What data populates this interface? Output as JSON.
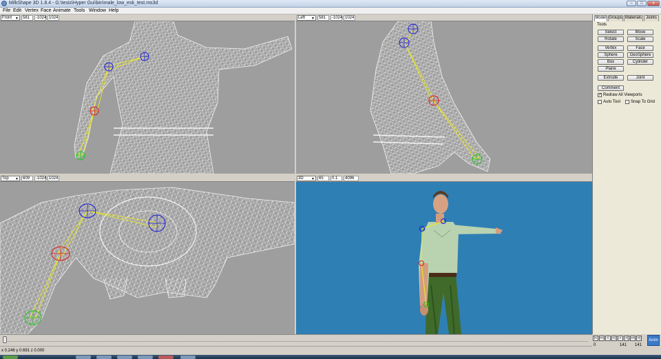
{
  "window": {
    "title": "MilkShape 3D 1.8.4 - G:\\tesis\\Hyper Gui\\bin\\male_low_esk_test.ms3d",
    "min_label": "–",
    "max_label": "□",
    "close_label": "x"
  },
  "menu": [
    "File",
    "Edit",
    "Vertex",
    "Face",
    "Animate",
    "Tools",
    "Window",
    "Help"
  ],
  "viewports": {
    "front": {
      "view": "Front",
      "v1": "581",
      "v2": "-1024",
      "v3": "1024"
    },
    "left": {
      "view": "Left",
      "v1": "581",
      "v2": "-1024",
      "v3": "1024"
    },
    "top": {
      "view": "Top",
      "v1": "609",
      "v2": "-1024",
      "v3": "1024"
    },
    "persp": {
      "view": "3D",
      "v1": "65",
      "v2": "0.1",
      "v3": "4096"
    }
  },
  "panel": {
    "tabs": [
      "Model",
      "Groups",
      "Materials",
      "Joints"
    ],
    "tools_label": "Tools",
    "buttons": [
      "Select",
      "Move",
      "Rotate",
      "Scale",
      "Vertex",
      "Face",
      "Sphere",
      "GeoSphere",
      "Box",
      "Cylinder",
      "Plane"
    ],
    "extrude": "Extrude",
    "joint": "Joint",
    "comment": "Comment",
    "redraw": "Redraw All Viewports",
    "auto_tool": "Auto Tool",
    "snap": "Snap To Grid",
    "redraw_checked": true
  },
  "timeline": {
    "frame_start": "0",
    "frame_current": "141",
    "frame_end": "141",
    "anim_label": "Anim",
    "controls": [
      "|<",
      "<<",
      "<",
      "<|",
      ">",
      ">|",
      ">>",
      ">|"
    ]
  },
  "status": {
    "coords": "x 0.246 y 0.691 z 0.000"
  },
  "colors": {
    "viewport_bg": "#9e9e9e",
    "persp_bg": "#2e7fb4",
    "joint_blue": "#1a1ad8",
    "joint_red": "#e01818",
    "joint_green": "#18c818",
    "bone": "#f0f018",
    "wire": "#e8e8e8"
  }
}
